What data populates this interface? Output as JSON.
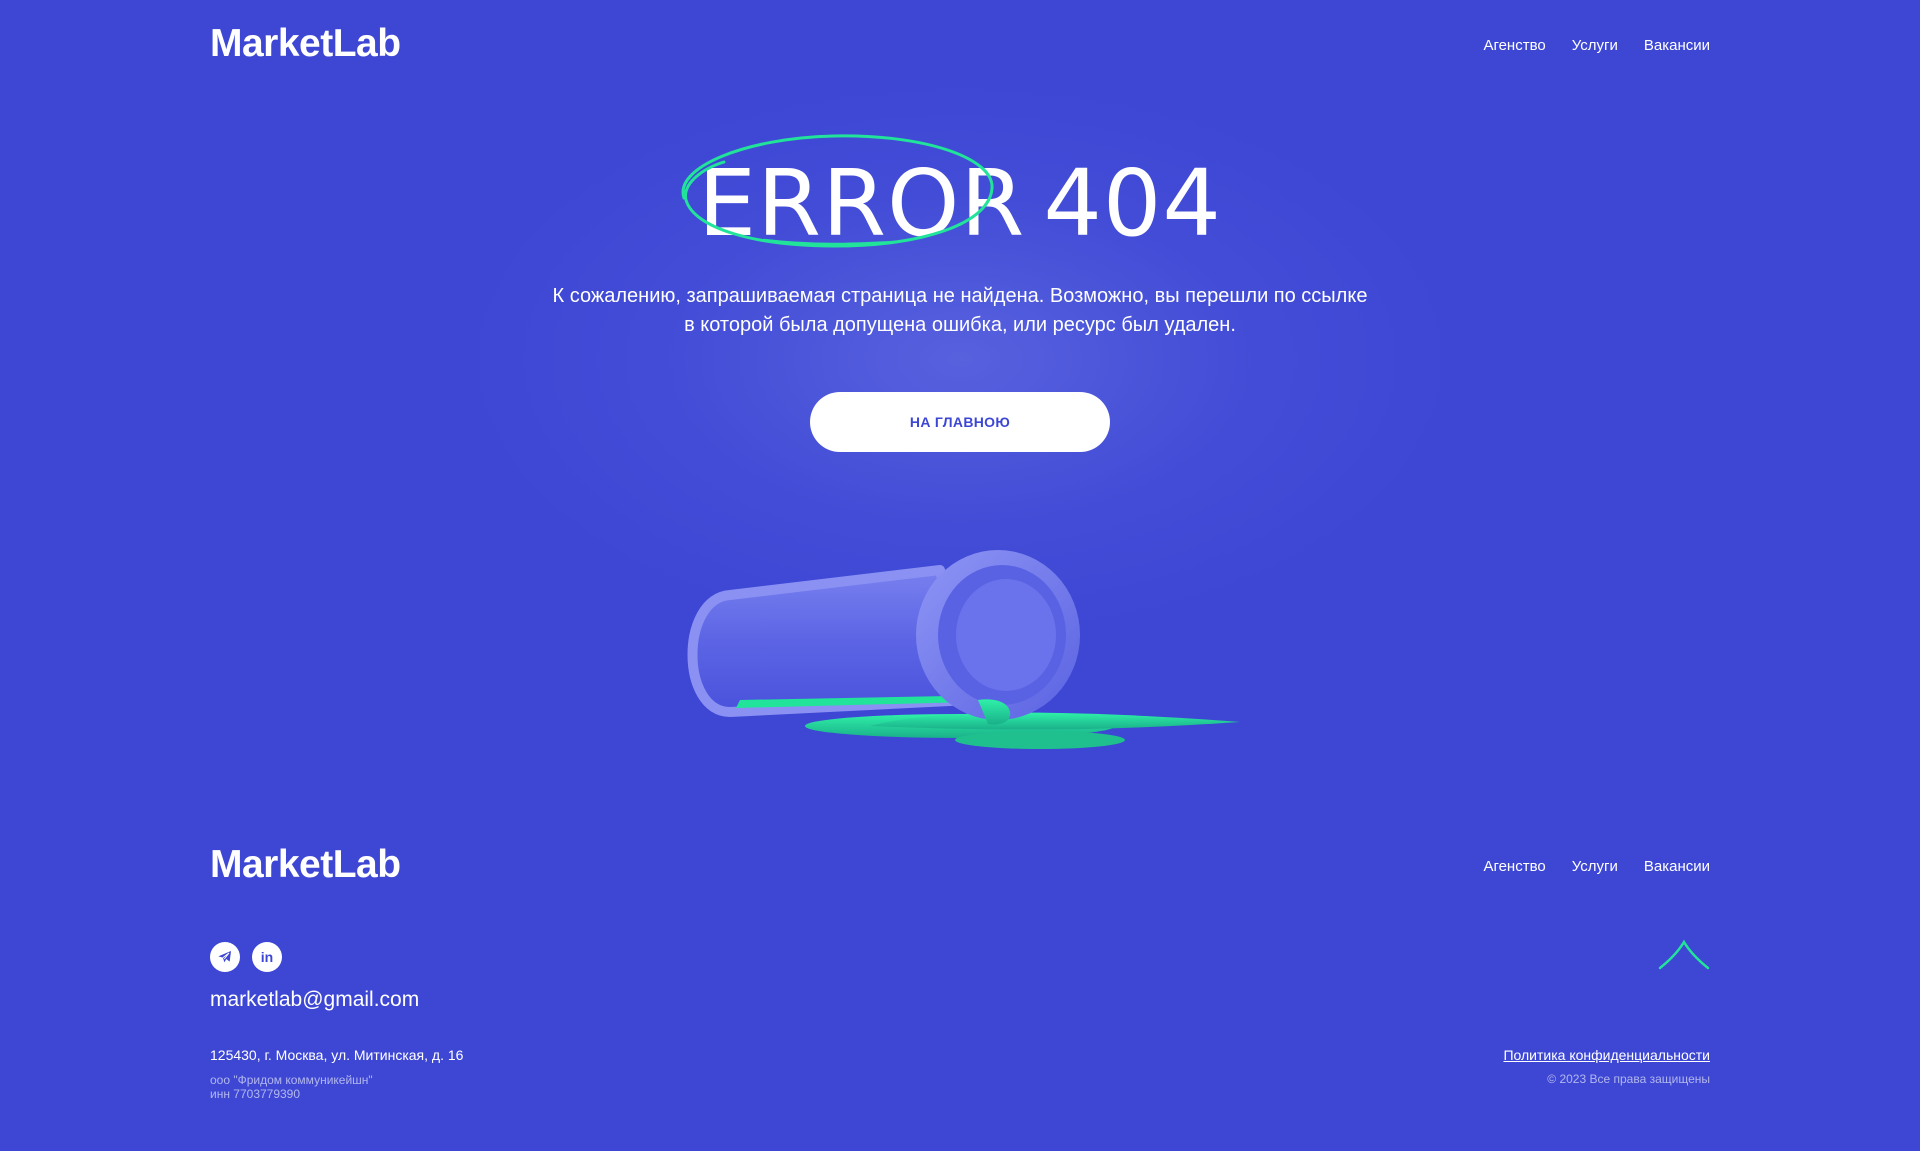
{
  "brand": {
    "logo_text": "MarketLab"
  },
  "header": {
    "nav": [
      {
        "label": "Агенство"
      },
      {
        "label": "Услуги"
      },
      {
        "label": "Вакансии"
      }
    ]
  },
  "error": {
    "word": "ERROR",
    "code": "404",
    "description_line1": "К сожалению, запрашиваемая страница не найдена. Возможно, вы перешли по ссылке",
    "description_line2": "в которой была допущена ошибка, или ресурс был удален.",
    "home_button_label": "НА ГЛАВНОЮ"
  },
  "footer": {
    "logo_text": "MarketLab",
    "nav": [
      {
        "label": "Агенство"
      },
      {
        "label": "Услуги"
      },
      {
        "label": "Вакансии"
      }
    ],
    "social": [
      {
        "icon": "telegram-icon"
      },
      {
        "icon": "linkedin-icon",
        "glyph": "in"
      }
    ],
    "email": "marketlab@gmail.com",
    "address": "125430, г. Москва, ул. Митинская, д. 16",
    "company": "ооо \"Фридом коммуникейшн\"",
    "inn": "инн 7703779390",
    "policy_link": "Политика конфиденциальности",
    "copyright": "© 2023 Все права защищены"
  },
  "colors": {
    "background": "#3d47d4",
    "accent_green": "#22e39a",
    "button_bg": "#ffffff",
    "button_text": "#3d47d4"
  }
}
